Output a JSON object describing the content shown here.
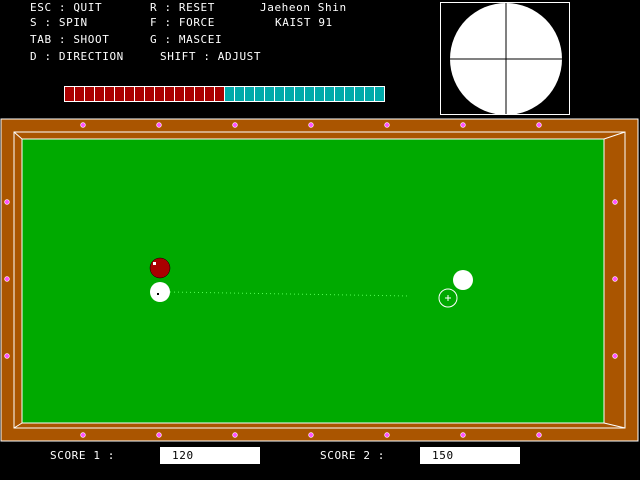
{
  "help": {
    "row1": [
      "ESC : QUIT",
      "R : RESET",
      "Jaeheon Shin"
    ],
    "row2": [
      "S : SPIN",
      "F : FORCE",
      "KAIST 91"
    ],
    "row3": [
      "TAB : SHOOT",
      "G : MASCEI"
    ],
    "row4": [
      "D : DIRECTION",
      "SHIFT : ADJUST"
    ]
  },
  "force_meter": {
    "total_cells": 32,
    "filled_cells": 16,
    "filled_fraction": 0.5,
    "filled_color": "#aa0000",
    "empty_color": "#00aaaa"
  },
  "spin_indicator": {
    "spin_x": 0,
    "spin_y": 0,
    "ball_color": "#ffffff",
    "crosshair_color": "#000000"
  },
  "table": {
    "rail_color": "#aa5500",
    "felt_color": "#00aa00",
    "cushion_line_color": "#ffffff",
    "diamond_color": "#ff55ff"
  },
  "balls": [
    {
      "name": "red-ball",
      "color": "#aa0000"
    },
    {
      "name": "cue-ball",
      "color": "#ffffff"
    },
    {
      "name": "object-ball-white",
      "color": "#ffffff"
    }
  ],
  "aim": {
    "target_marker": "+"
  },
  "scores": {
    "score1_label": "SCORE 1 :",
    "score1_value": "120",
    "score2_label": "SCORE 2 :",
    "score2_value": "150"
  }
}
